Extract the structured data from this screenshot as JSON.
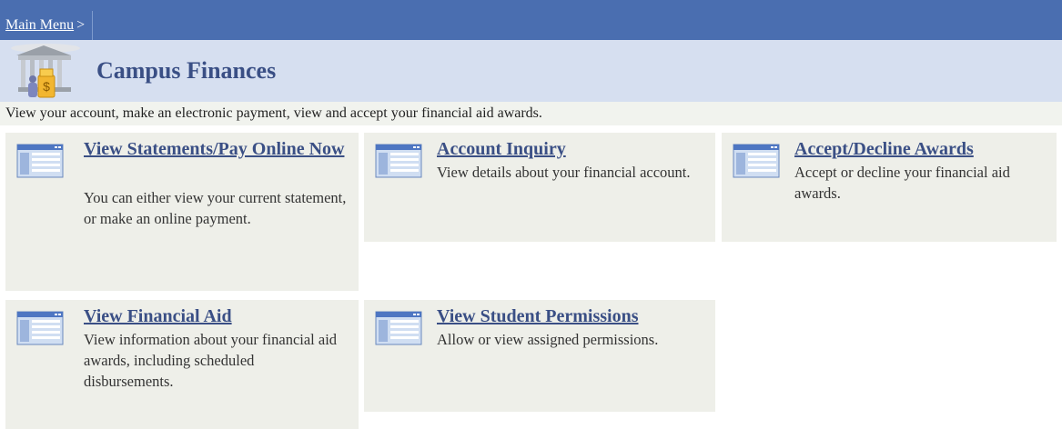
{
  "breadcrumb": {
    "link": "Main Menu",
    "separator": ">"
  },
  "header": {
    "title": "Campus Finances",
    "icon": "bank-building-icon"
  },
  "description": "View your account, make an electronic payment, view and accept your financial aid awards.",
  "tiles": [
    {
      "title": "View Statements/Pay Online Now",
      "text": "You can either view your current statement, or make an online payment.",
      "icon": "window-page-icon"
    },
    {
      "title": "Account Inquiry",
      "text": "View details about your financial account.",
      "icon": "window-page-icon"
    },
    {
      "title": "Accept/Decline Awards",
      "text": "Accept or decline your financial aid awards.",
      "icon": "window-page-icon"
    },
    {
      "title": "View Financial Aid",
      "text": "View information about your financial aid awards, including scheduled disbursements.",
      "icon": "window-page-icon"
    },
    {
      "title": "View Student Permissions",
      "text": "Allow or view assigned permissions.",
      "icon": "window-page-icon"
    }
  ],
  "colors": {
    "nav_bar": "#4a6eb0",
    "header_bg": "#d6dff0",
    "tile_bg": "#eeefe9",
    "link": "#3a4f85"
  }
}
